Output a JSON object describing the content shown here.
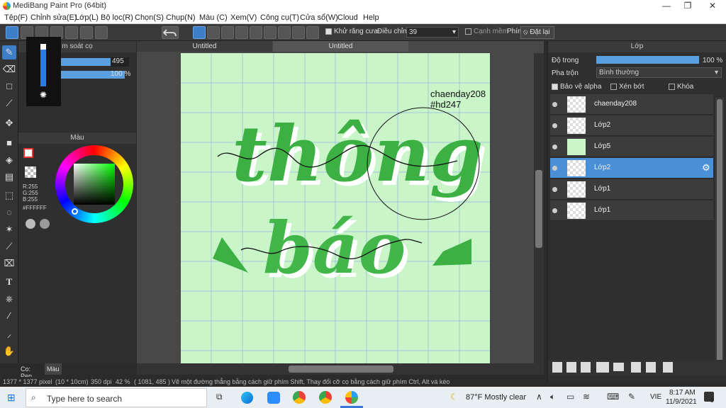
{
  "window": {
    "title": "MediBang Paint Pro (64bit)",
    "minimize": "—",
    "maximize": "❐",
    "close": "✕"
  },
  "menu": [
    "Tệp(F)",
    "Chỉnh sửa(E)",
    "Lớp(L)",
    "Bộ lọc(R)",
    "Chọn(S)",
    "Chụp(N)",
    "Màu (C)",
    "Xem(V)",
    "Công cụ(T)",
    "Cửa sổ(W)",
    "Cloud",
    "Help"
  ],
  "toolbar": {
    "antialias_label": "Khử răng cưa",
    "antialias_checked": true,
    "adjust_label": "Điều chỉnh",
    "adjust_value": "39",
    "soft_edge_label": "Cạnh mềm",
    "soft_edge_checked": false,
    "key_label": "Phím",
    "reset_label": "Đặt lại"
  },
  "brush_panel": {
    "title": "m soát cọ",
    "size_value": "495",
    "opacity_value": "100 %"
  },
  "color_panel": {
    "title": "Màu",
    "r": "R:255",
    "g": "G:255",
    "b": "B:255",
    "hex": "#FFFFFF"
  },
  "canvas_tabs": [
    "Untitled",
    "Untitled"
  ],
  "canvas_text": {
    "line1": "chaenday208",
    "line2": "#hd247"
  },
  "artwork": {
    "word1": "thông",
    "word2": "báo"
  },
  "layer_panel": {
    "title": "Lớp",
    "opacity_label": "Độ trong",
    "opacity_value": "100 %",
    "opacity_level": 1.0,
    "blend_label": "Pha trộn",
    "blend_value": "Bình thường",
    "protect_alpha": "Bảo vệ alpha",
    "clipping": "Xén bớt",
    "lock": "Khóa",
    "layers": [
      {
        "name": "chaenday208",
        "selected": false
      },
      {
        "name": "Lớp2",
        "selected": false
      },
      {
        "name": "Lớp5",
        "selected": false
      },
      {
        "name": "Lớp2",
        "selected": true
      },
      {
        "name": "Lớp1",
        "selected": false
      },
      {
        "name": "Lớp1",
        "selected": false
      }
    ]
  },
  "bottom_tabs": [
    "Co: Pen",
    "Màu"
  ],
  "status": {
    "size": "1377 * 1377 pixel",
    "cm": "(10 * 10cm)",
    "dpi": "350 dpi",
    "zoom": "42 %",
    "coords": "( 1081, 485 )",
    "hint": "Vẽ một đường thẳng bằng cách giữ phím Shift, Thay đổi cỡ cọ bằng cách giữ phím Ctrl, Alt và kéo"
  },
  "taskbar": {
    "search_placeholder": "Type here to search",
    "weather": "87°F  Mostly clear",
    "lang": "VIE",
    "time": "8:17 AM",
    "date": "11/9/2021",
    "notif": "3"
  },
  "colors": {
    "accent": "#4a90d9",
    "canvas_bg": "#c9f5c9",
    "lettering": "#3cb043"
  }
}
